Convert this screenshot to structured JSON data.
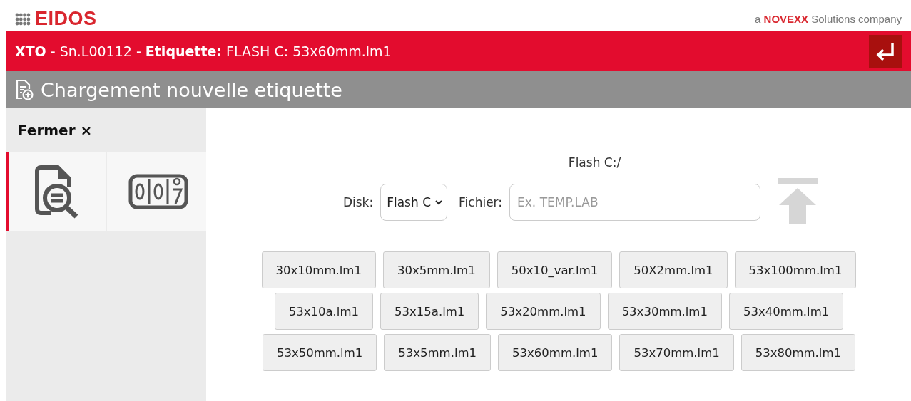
{
  "brand": {
    "logo": "EIDOS",
    "tagline_prefix": "a",
    "tagline_brand": "NOVEXX",
    "tagline_suffix": "Solutions company"
  },
  "title_bar": {
    "text": "**XTO** - Sn.L00112 - **Etiquette:** FLASH C: 53x60mm.lm1"
  },
  "section_title": "Chargement nouvelle etiquette",
  "sidebar": {
    "close_label": "Fermer ×",
    "tiles": [
      {
        "kind": "search-file",
        "selected": true
      },
      {
        "kind": "counter",
        "selected": false
      }
    ]
  },
  "path": "Flash C:/",
  "disk": {
    "label": "Disk:",
    "value": "Flash C"
  },
  "file": {
    "label": "Fichier:",
    "placeholder": "Ex. TEMP.LAB"
  },
  "upload": {
    "disabled": true
  },
  "file_rows": [
    [
      "30x10mm.lm1",
      "30x5mm.lm1",
      "50x10_var.lm1",
      "50X2mm.lm1",
      "53x100mm.lm1"
    ],
    [
      "53x10a.lm1",
      "53x15a.lm1",
      "53x20mm.lm1",
      "53x30mm.lm1",
      "53x40mm.lm1"
    ],
    [
      "53x50mm.lm1",
      "53x5mm.lm1",
      "53x60mm.lm1",
      "53x70mm.lm1",
      "53x80mm.lm1"
    ]
  ]
}
